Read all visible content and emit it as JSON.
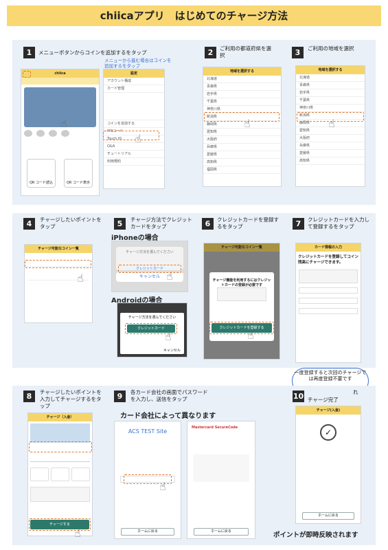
{
  "title": "chiicaアプリ　はじめてのチャージ方法",
  "steps": [
    {
      "n": "1",
      "text": "メニューボタンからコインを追加するをタップ",
      "note": "メニューから進む場合はコインを追加するをタップ"
    },
    {
      "n": "2",
      "text": "ご利用の都道府県を選択"
    },
    {
      "n": "3",
      "text": "ご利用の地域を選択"
    },
    {
      "n": "4",
      "text": "チャージしたいポイントをタップ"
    },
    {
      "n": "5",
      "text": "チャージ方法でクレジットカードをタップ"
    },
    {
      "n": "6",
      "text": "クレジットカードを登録するをタップ"
    },
    {
      "n": "7",
      "text": "クレジットカードを入力して登録するをタップ"
    },
    {
      "n": "8",
      "text": "チャージしたいポイントを入力してチャージするをタップ"
    },
    {
      "n": "9",
      "text": "各カード会社の画面でパスワードを入力し、送信をタップ"
    },
    {
      "n": "10",
      "text": "チャージ完了"
    }
  ],
  "labels": {
    "iphone": "iPhoneの場合",
    "android": "Androidの場合",
    "card_company": "カード会社によって異なります",
    "points_reflected": "ポイントが即時反映されます",
    "bubble": "一度登録すると次回のチャージでは再度登録不要です",
    "bubble_tail": "れ"
  },
  "screens": {
    "app_name": "chiica",
    "region_header": "地域を選択する",
    "prefectures": [
      "北海道",
      "青森県",
      "岩手県",
      "千葉県",
      "神奈川県",
      "新潟県",
      "静岡県",
      "愛知県",
      "大阪府",
      "兵庫県",
      "愛媛県",
      "高知県",
      "福岡県"
    ],
    "menu_title": "設定",
    "menu_items": [
      "アカウント構成",
      "カード管理",
      "コインを追加する",
      "PINコード",
      "Touch ID",
      "Q&A",
      "チュートリアル",
      "利用規約"
    ],
    "qr_read": "QR コード読込",
    "qr_show": "QR コード表示",
    "coin_list_header": "チャージ可能なコイン一覧",
    "charge_method_title": "チャージ方法を選んでください",
    "credit_card": "クレジットカード",
    "cancel": "キャンセル",
    "register_prompt": "チャージ機能を利用するにはクレジットカードの登録が必要です",
    "register_button": "クレジットカードを登録する",
    "card_info_header": "カード情報の入力",
    "card_info_title": "クレジットカードを登録してコイン残高にチャージできます。",
    "charge_header": "チャージ（入金）",
    "charge_button": "チャージする",
    "acs_site": "ACS TEST Site",
    "mastercard": "Mastercard SecureCode",
    "home_button": "ホームに戻る",
    "complete_header": "チャージ(入金)"
  }
}
